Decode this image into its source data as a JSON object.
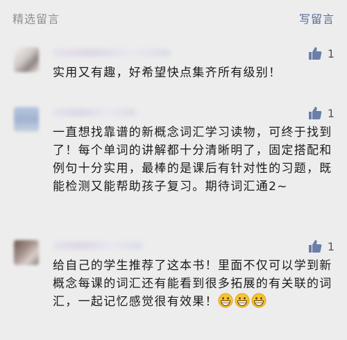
{
  "header": {
    "title": "精选留言",
    "write_label": "写留言"
  },
  "comments": [
    {
      "likes": "1",
      "text": "实用又有趣，好希望快点集齐所有级别！"
    },
    {
      "likes": "1",
      "text": "一直想找靠谱的新概念词汇学习读物，可终于找到了！每个单词的讲解都十分清晰明了，固定搭配和例句十分实用，最棒的是课后有针对性的习题，既能检测又能帮助孩子复习。期待词汇通2~"
    },
    {
      "likes": "1",
      "text": "给自己的学生推荐了这本书！里面不仅可以学到新概念每课的词汇还有能看到很多拓展的有关联的词汇，一起记忆感觉很有效果！"
    }
  ],
  "colors": {
    "background": "#ededed",
    "link": "#576b95",
    "muted": "#8e8e8e",
    "thumb": "#6a7fa8"
  },
  "icons": {
    "like": "thumbs-up-icon",
    "emoji": "grinning-face-icon"
  }
}
